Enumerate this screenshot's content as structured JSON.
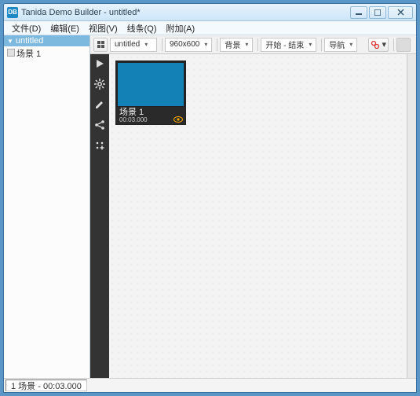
{
  "title": "Tanida Demo Builder - untitled*",
  "icon_text": "DB",
  "menu": [
    "文件(D)",
    "编辑(E)",
    "视图(V)",
    "线条(Q)",
    "附加(A)"
  ],
  "sidebar": {
    "header": "untitled",
    "items": [
      {
        "label": "场景 1"
      }
    ]
  },
  "toolbar": {
    "scene_select": "untitled",
    "resolution": "960x600",
    "background": "背景",
    "start_end": "开始 - 结束",
    "nav": "导航"
  },
  "thumb": {
    "name": "场景 1",
    "time": "00:03.000"
  },
  "status": "1 场景 - 00:03.000"
}
